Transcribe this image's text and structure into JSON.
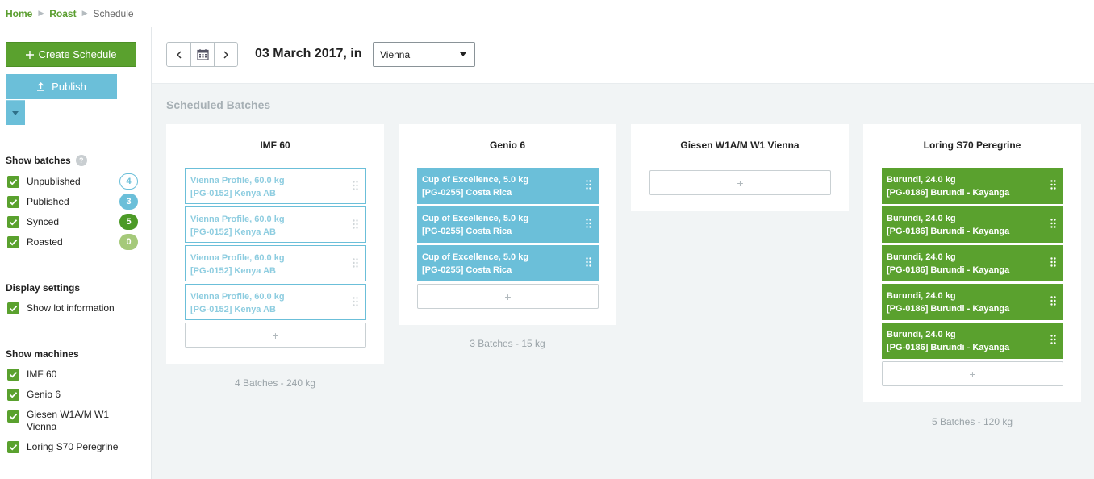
{
  "breadcrumb": {
    "home": "Home",
    "roast": "Roast",
    "current": "Schedule"
  },
  "sidebar": {
    "create_label": "Create Schedule",
    "publish_label": "Publish",
    "show_batches_heading": "Show batches",
    "help": "?",
    "batch_filters": [
      {
        "label": "Unpublished",
        "count": "4"
      },
      {
        "label": "Published",
        "count": "3"
      },
      {
        "label": "Synced",
        "count": "5"
      },
      {
        "label": "Roasted",
        "count": "0"
      }
    ],
    "display_heading": "Display settings",
    "show_lot_label": "Show lot information",
    "machines_heading": "Show machines",
    "machine_filters": [
      "IMF 60",
      "Genio 6",
      "Giesen W1A/M W1 Vienna",
      "Loring S70 Peregrine"
    ]
  },
  "toolbar": {
    "date_title": "03 March 2017, in",
    "location": "Vienna"
  },
  "main": {
    "section_title": "Scheduled Batches",
    "add_symbol": "+",
    "machines": [
      {
        "name": "IMF 60",
        "summary": "4 Batches - 240 kg",
        "batches": [
          {
            "line1": "Vienna Profile, 60.0 kg",
            "line2": "[PG-0152] Kenya AB"
          },
          {
            "line1": "Vienna Profile, 60.0 kg",
            "line2": "[PG-0152] Kenya AB"
          },
          {
            "line1": "Vienna Profile, 60.0 kg",
            "line2": "[PG-0152] Kenya AB"
          },
          {
            "line1": "Vienna Profile, 60.0 kg",
            "line2": "[PG-0152] Kenya AB"
          }
        ]
      },
      {
        "name": "Genio 6",
        "summary": "3 Batches - 15 kg",
        "batches": [
          {
            "line1": "Cup of Excellence, 5.0 kg",
            "line2": "[PG-0255] Costa Rica"
          },
          {
            "line1": "Cup of Excellence, 5.0 kg",
            "line2": "[PG-0255] Costa Rica"
          },
          {
            "line1": "Cup of Excellence, 5.0 kg",
            "line2": "[PG-0255] Costa Rica"
          }
        ]
      },
      {
        "name": "Giesen W1A/M W1 Vienna",
        "summary": "",
        "batches": []
      },
      {
        "name": "Loring S70 Peregrine",
        "summary": "5 Batches - 120 kg",
        "batches": [
          {
            "line1": "Burundi, 24.0 kg",
            "line2": "[PG-0186] Burundi - Kayanga"
          },
          {
            "line1": "Burundi, 24.0 kg",
            "line2": "[PG-0186] Burundi - Kayanga"
          },
          {
            "line1": "Burundi, 24.0 kg",
            "line2": "[PG-0186] Burundi - Kayanga"
          },
          {
            "line1": "Burundi, 24.0 kg",
            "line2": "[PG-0186] Burundi - Kayanga"
          },
          {
            "line1": "Burundi, 24.0 kg",
            "line2": "[PG-0186] Burundi - Kayanga"
          }
        ]
      }
    ]
  },
  "colors": {
    "green": "#5aa12e",
    "blue": "#6bbfd9",
    "muted": "#a7b0b5"
  },
  "icons": {
    "add": "plus-icon",
    "publish": "upload-icon",
    "calendar": "calendar-icon",
    "handle": "drag-handle-icon"
  }
}
